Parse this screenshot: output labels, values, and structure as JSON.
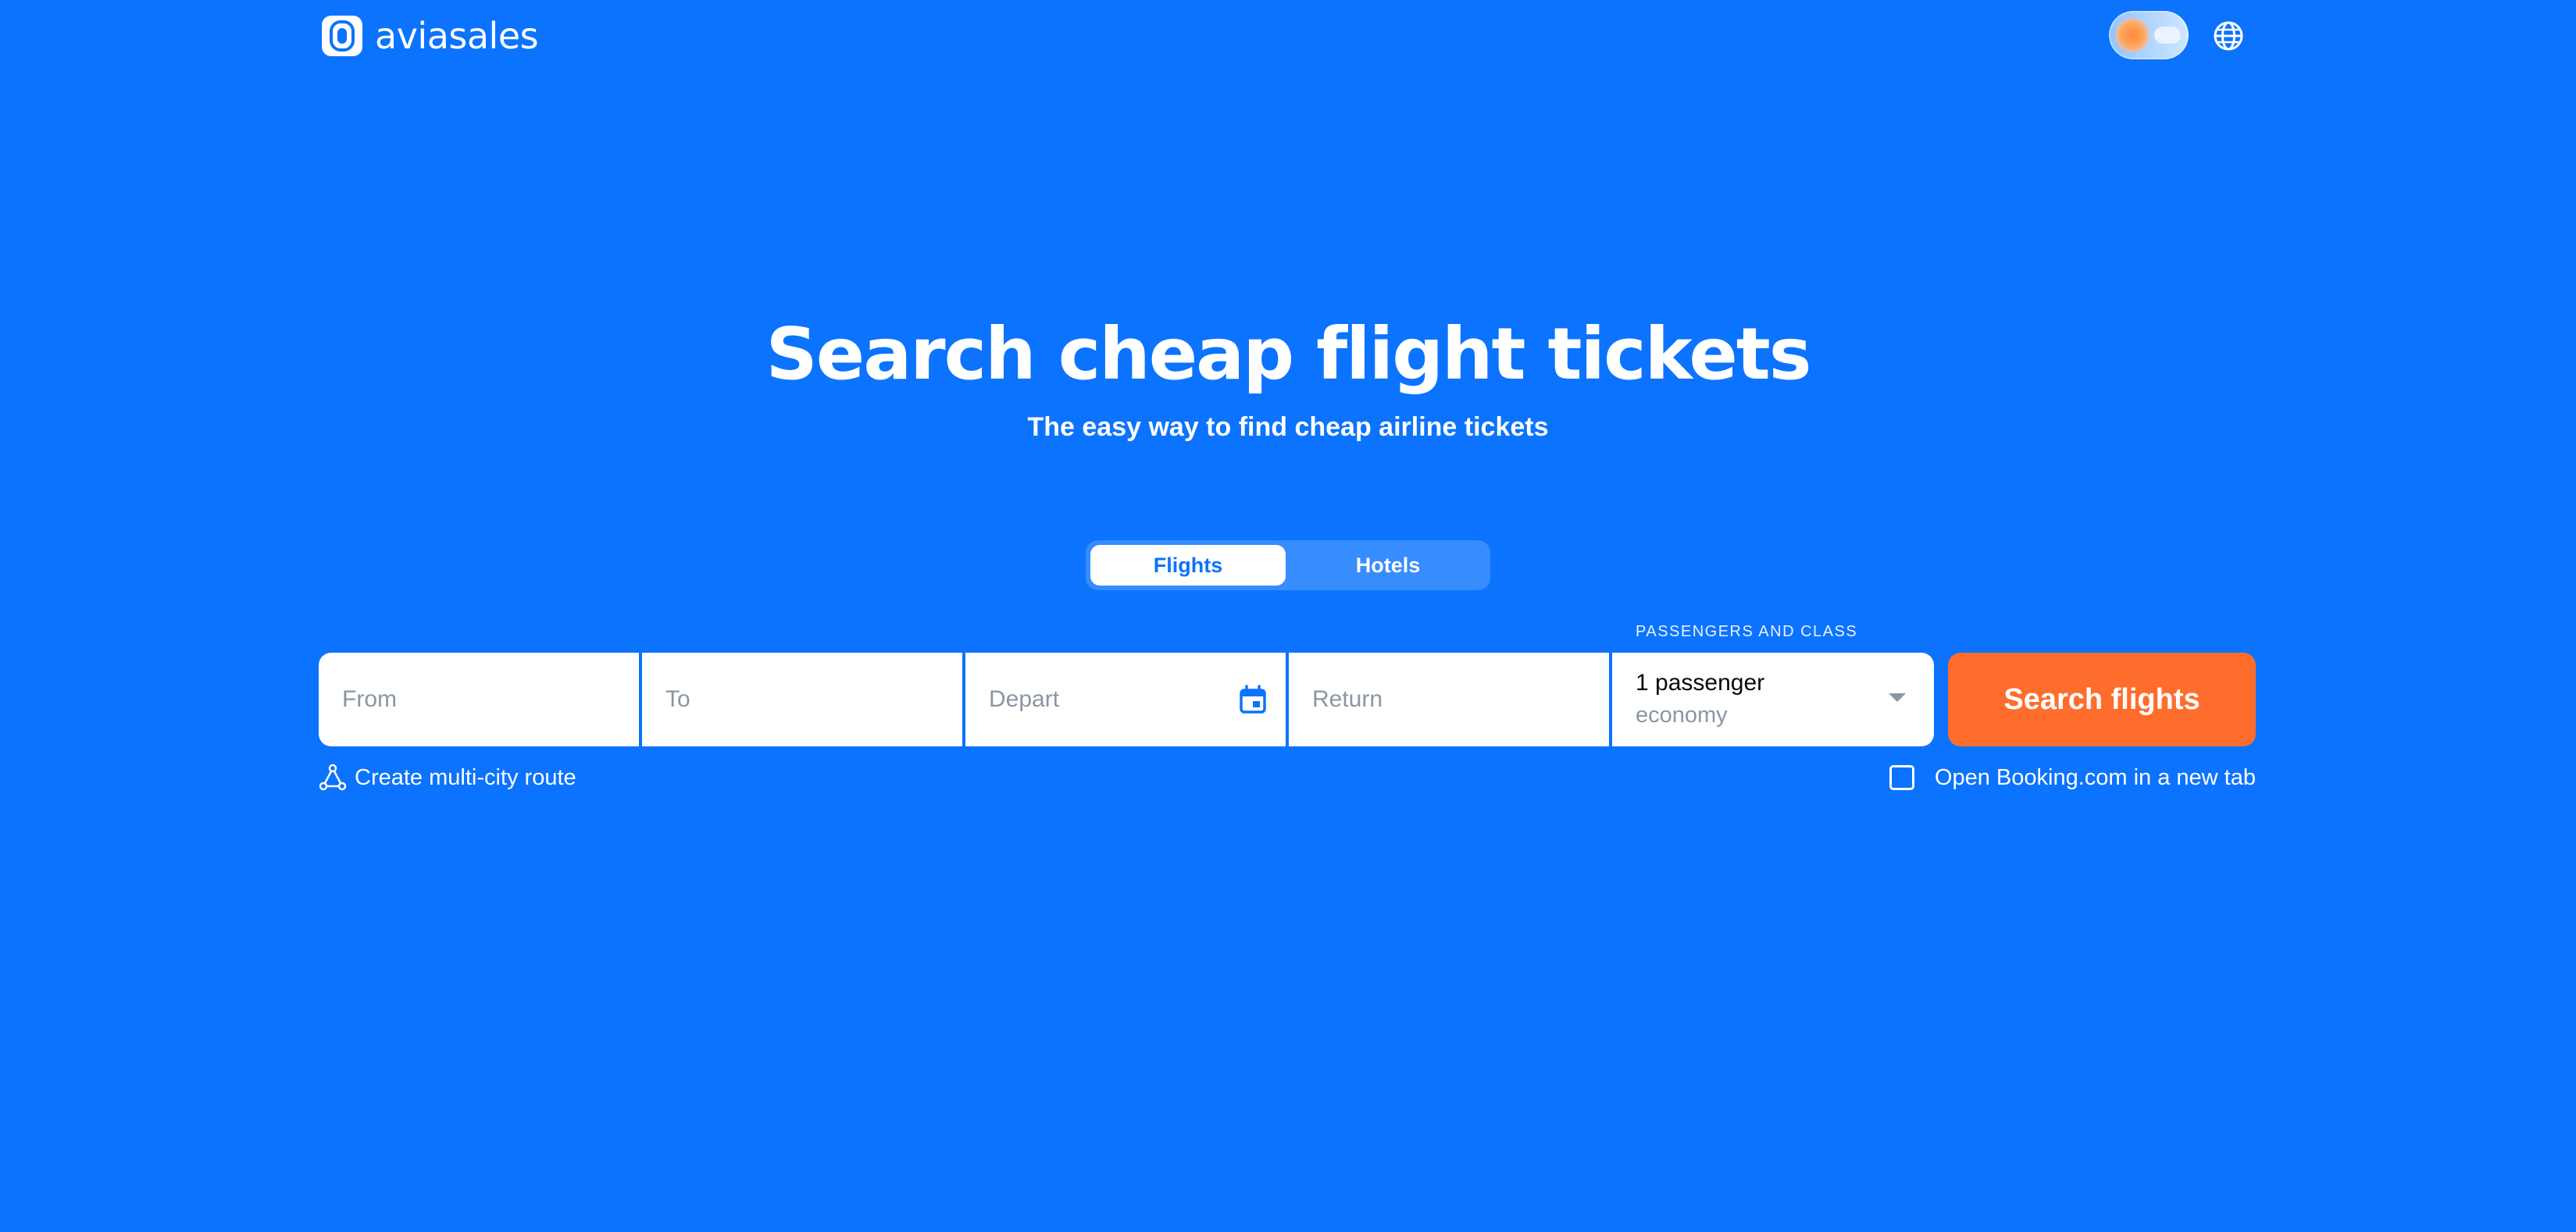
{
  "header": {
    "logo_text": "aviasales",
    "logo_icon": "aviasales-logo-icon",
    "theme_toggle_icon": "sun-cloud-theme-toggle-icon",
    "language_icon": "globe-icon"
  },
  "hero": {
    "title": "Search cheap flight tickets",
    "subtitle": "The easy way to find cheap airline tickets"
  },
  "tabs": [
    {
      "label": "Flights",
      "active": true
    },
    {
      "label": "Hotels",
      "active": false
    }
  ],
  "search": {
    "from_placeholder": "From",
    "to_placeholder": "To",
    "depart_placeholder": "Depart",
    "return_placeholder": "Return",
    "calendar_icon": "calendar-icon",
    "passengers_caption": "PASSENGERS AND CLASS",
    "passengers_value": "1 passenger",
    "class_value": "economy",
    "submit_label": "Search flights"
  },
  "options": {
    "multi_city_label": "Create multi-city route",
    "multi_city_icon": "route-icon",
    "booking_label": "Open Booking.com in a new tab",
    "booking_checked": false
  },
  "colors": {
    "background": "#0c73fe",
    "accent_button": "#ff6d2c",
    "field_background": "#ffffff"
  }
}
